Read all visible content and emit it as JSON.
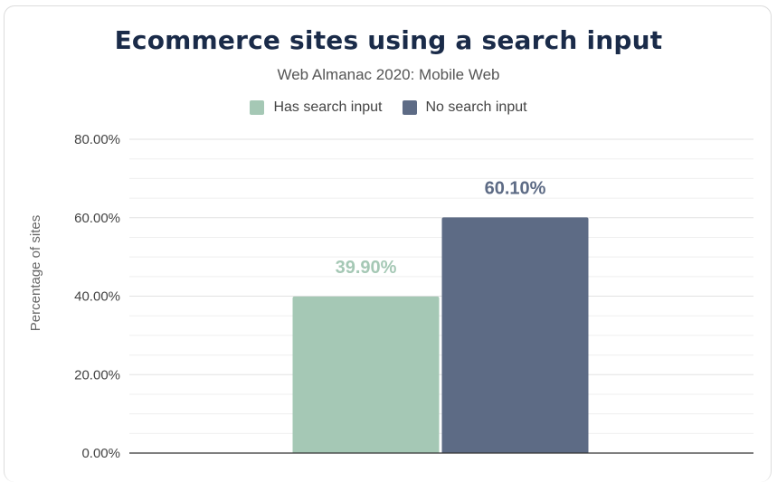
{
  "chart_data": {
    "type": "bar",
    "title": "Ecommerce sites using a search input",
    "subtitle": "Web Almanac 2020: Mobile Web",
    "ylabel": "Percentage of sites",
    "xlabel": "",
    "ylim": [
      0,
      80
    ],
    "yticks": [
      "0.00%",
      "20.00%",
      "40.00%",
      "60.00%",
      "80.00%"
    ],
    "legend_position": "top",
    "grid": true,
    "series": [
      {
        "name": "Has search input",
        "values": [
          39.9
        ],
        "label": "39.90%",
        "color": "#a5c8b5"
      },
      {
        "name": "No search input",
        "values": [
          60.1
        ],
        "label": "60.10%",
        "color": "#5d6b85"
      }
    ]
  }
}
